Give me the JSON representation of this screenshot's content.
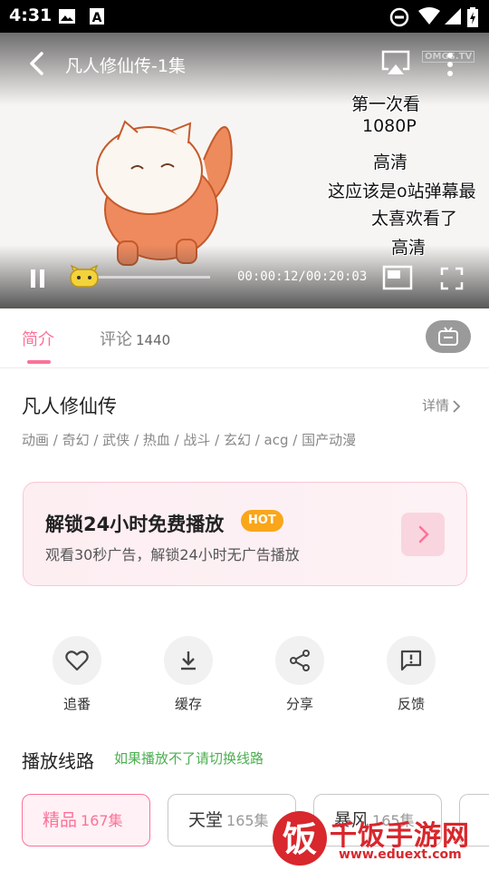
{
  "status_bar": {
    "time": "4:31",
    "icons": [
      "image-icon",
      "a-notification-icon",
      "do-not-disturb-icon",
      "wifi-icon",
      "signal-icon",
      "battery-icon"
    ]
  },
  "player": {
    "title": "凡人修仙传-1集",
    "time_text": "00:00:12/00:20:03",
    "progress_fraction": 0.01,
    "watermark": "OMGS.TV",
    "danmaku": [
      "第一次看",
      "1080P",
      "高清",
      "这应该是o站弹幕最",
      "太喜欢看了",
      "高清"
    ]
  },
  "tabs": {
    "intro": "简介",
    "comments": "评论",
    "comment_count": "1440"
  },
  "show": {
    "title": "凡人修仙传",
    "details_label": "详情",
    "tags": "动画 / 奇幻 / 武侠 / 热血 / 战斗 / 玄幻 / acg / 国产动漫"
  },
  "promo": {
    "title": "解锁24小时免费播放",
    "badge": "HOT",
    "subtitle": "观看30秒广告，解锁24小时无广告播放"
  },
  "actions": [
    {
      "label": "追番",
      "icon": "heart-icon"
    },
    {
      "label": "缓存",
      "icon": "download-icon"
    },
    {
      "label": "分享",
      "icon": "share-icon"
    },
    {
      "label": "反馈",
      "icon": "feedback-icon"
    }
  ],
  "lines": {
    "title": "播放线路",
    "hint": "如果播放不了请切换线路",
    "items": [
      {
        "name": "精品",
        "count": "167集",
        "active": true
      },
      {
        "name": "天堂",
        "count": "165集",
        "active": false
      },
      {
        "name": "暴风",
        "count": "165集",
        "active": false
      }
    ]
  },
  "site_watermark": {
    "logo_char": "饭",
    "name": "千饭手游网",
    "url": "www.eduext.com"
  },
  "colors": {
    "accent": "#fb7299",
    "hot_badge": "#f9a61a",
    "hint_green": "#4caf50",
    "watermark_red": "#d8272d"
  }
}
